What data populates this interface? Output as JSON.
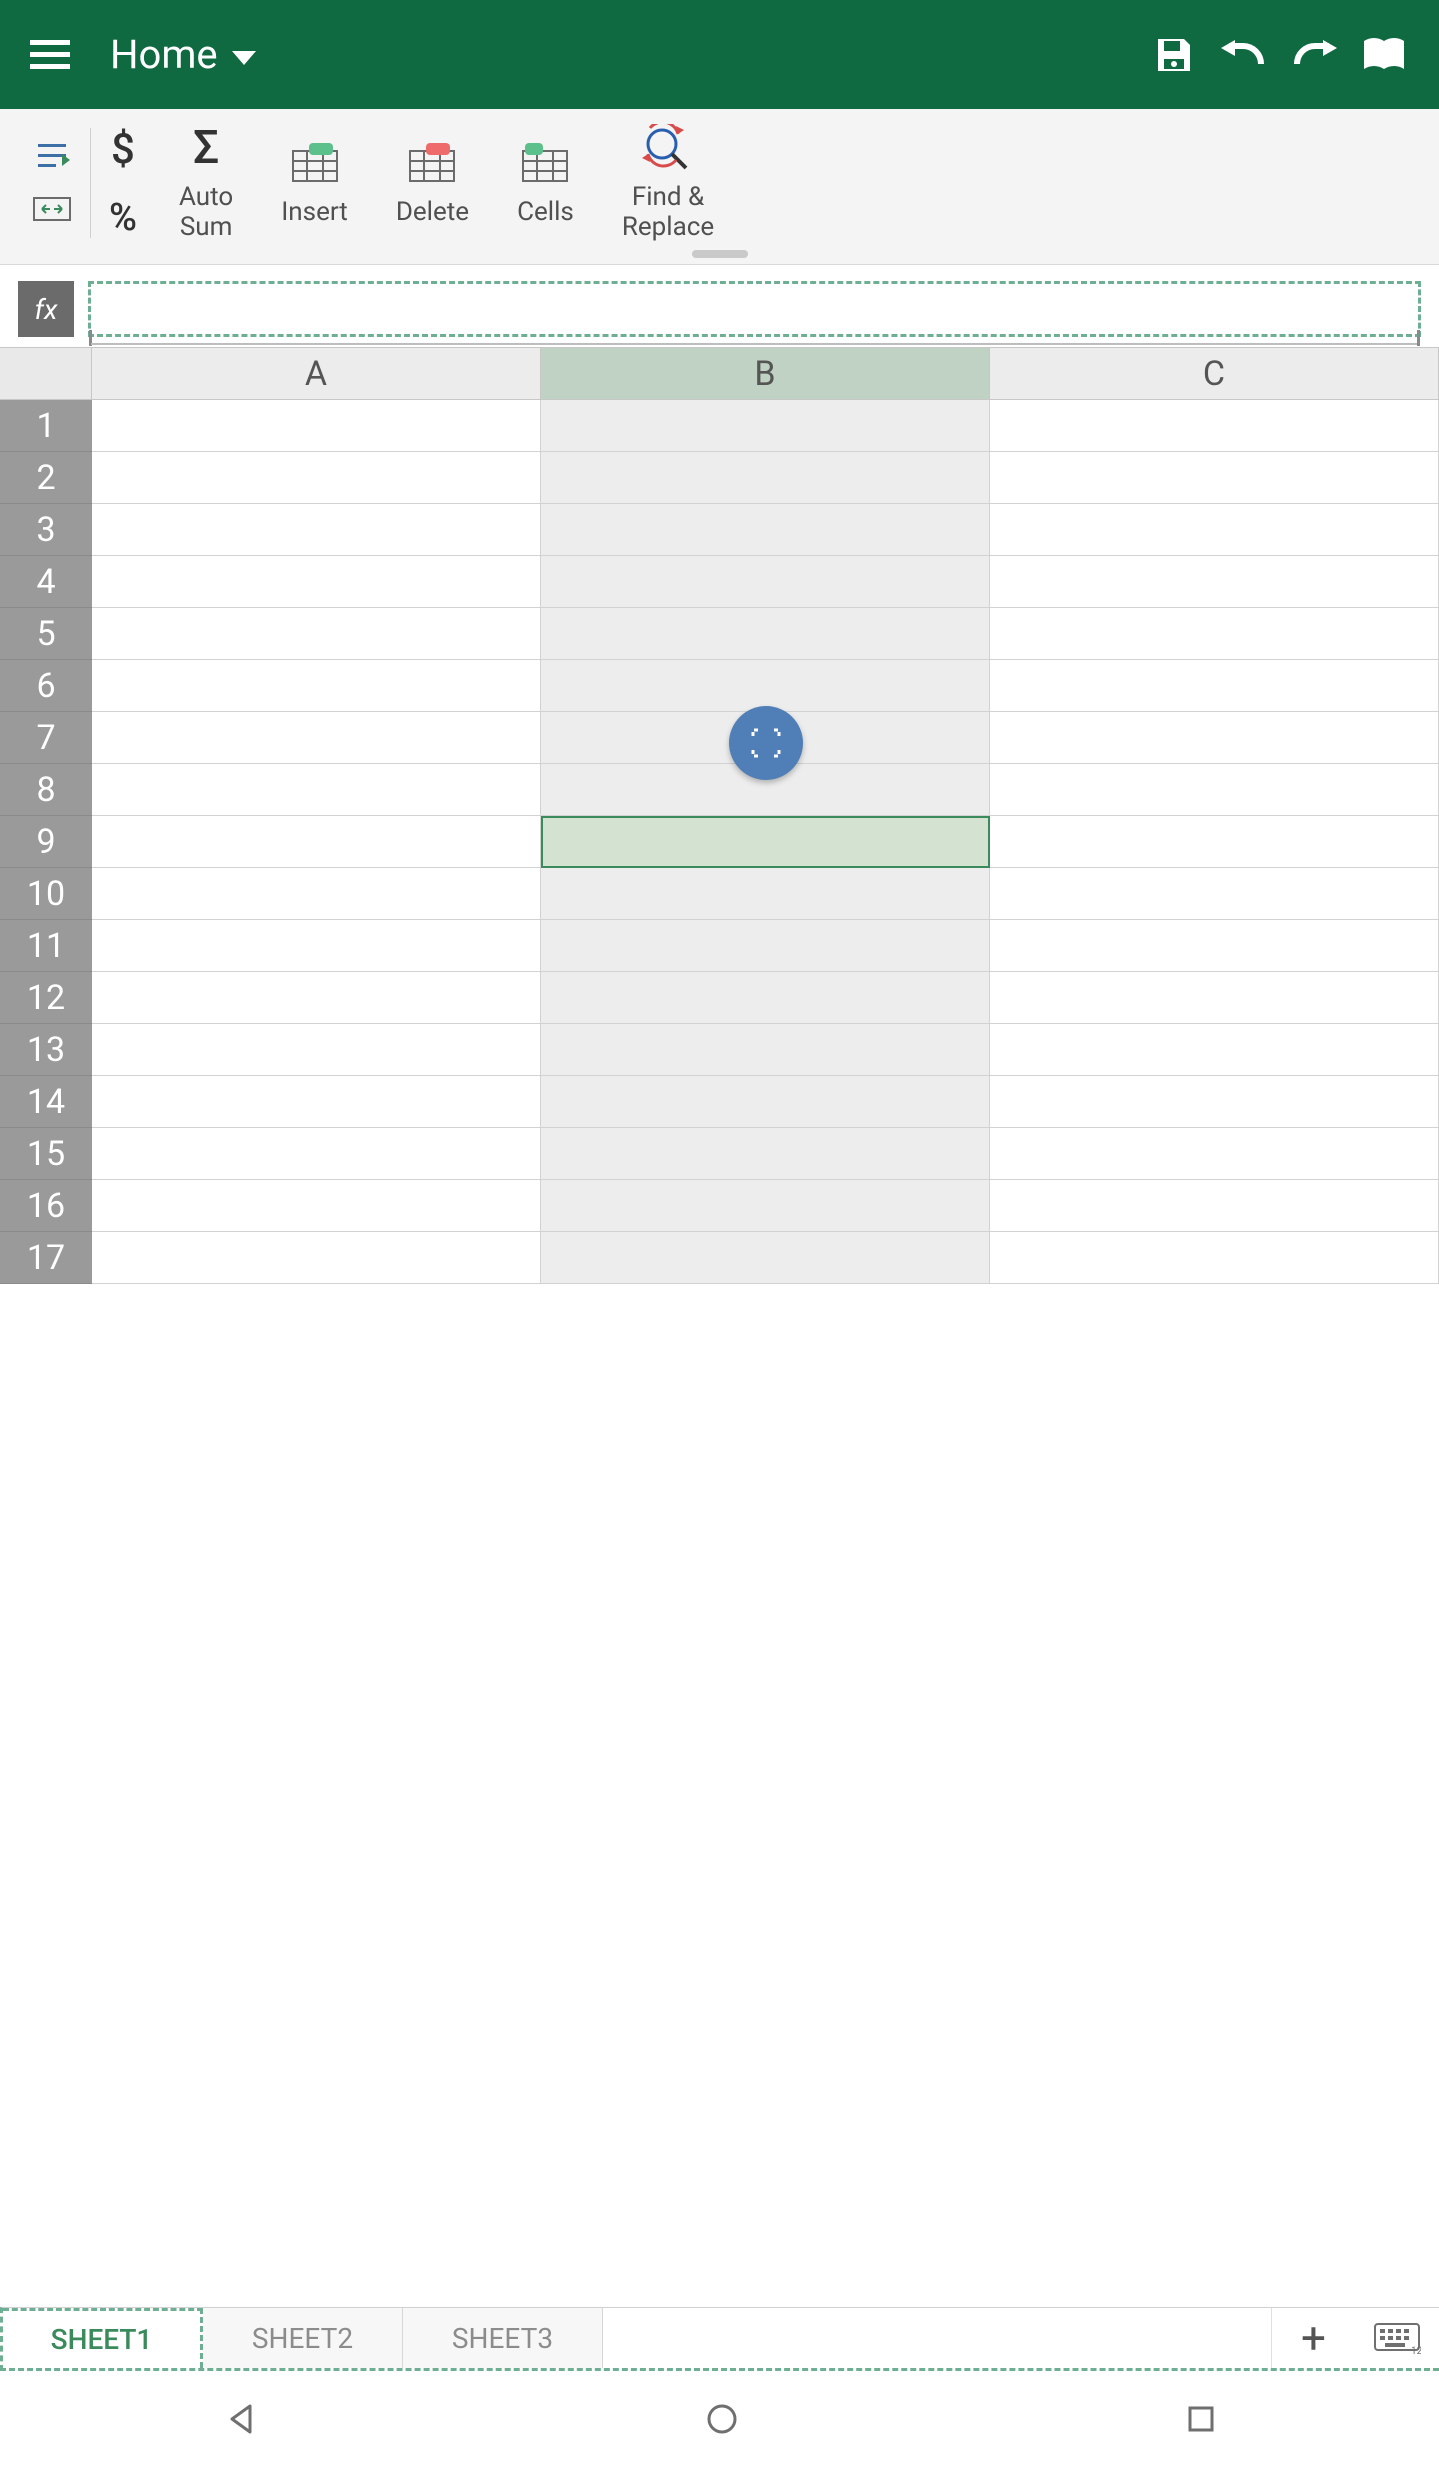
{
  "appbar": {
    "title": "Home"
  },
  "ribbon": {
    "currency_glyph": "$",
    "percent_glyph": "%",
    "sum_glyph": "Σ",
    "autosum_label": "Auto Sum",
    "insert_label": "Insert",
    "delete_label": "Delete",
    "cells_label": "Cells",
    "find_replace_label": "Find & Replace"
  },
  "formula": {
    "fx_label": "fx",
    "value": ""
  },
  "grid": {
    "columns": [
      "A",
      "B",
      "C"
    ],
    "rows": [
      "1",
      "2",
      "3",
      "4",
      "5",
      "6",
      "7",
      "8",
      "9",
      "10",
      "11",
      "12",
      "13",
      "14",
      "15",
      "16",
      "17"
    ],
    "selected_column_index": 1,
    "active_cell": {
      "row_index": 8,
      "col_index": 1
    },
    "fab_position_row": 6
  },
  "sheets": {
    "tabs": [
      "SHEET1",
      "SHEET2",
      "SHEET3"
    ],
    "active_index": 0,
    "add_glyph": "+"
  }
}
